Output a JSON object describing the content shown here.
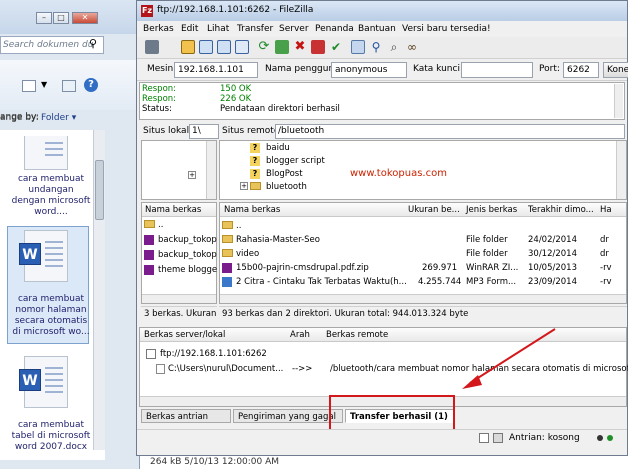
{
  "explorer": {
    "search_placeholder": "Search dokumen du",
    "arrange_label": "ange by:",
    "arrange_value": "Folder",
    "files": [
      "cara membuat undangan dengan microsoft word....",
      "cara membuat nomor halaman secara otomatis di microsoft wo...",
      "cara membuat tabel di microsoft word 2007.docx"
    ],
    "bottom_text": "264 kB      5/10/13  12:00:00 AM"
  },
  "filezilla": {
    "title": "ftp://192.168.1.101:6262 - FileZilla",
    "menu": [
      "Berkas",
      "Edit",
      "Lihat",
      "Transfer",
      "Server",
      "Penanda",
      "Bantuan",
      "Versi baru tersedia!"
    ],
    "conn": {
      "host_label": "Mesin:",
      "host_value": "192.168.1.101",
      "user_label": "Nama pengguna:",
      "user_value": "anonymous",
      "pass_label": "Kata kunci:",
      "pass_value": "",
      "port_label": "Port:",
      "port_value": "6262",
      "connect_label": "Kone"
    },
    "log": [
      {
        "label": "Respon:",
        "text": "150 OK",
        "color": "#008000"
      },
      {
        "label": "Respon:",
        "text": "226 OK",
        "color": "#008000"
      },
      {
        "label": "Status:",
        "text": "Pendataan direktori berhasil",
        "color": "#000000"
      }
    ],
    "local_site_label": "Situs lokal:",
    "local_site_value": "1\\",
    "remote_site_label": "Situs remote:",
    "remote_site_value": "/bluetooth",
    "remote_tree": [
      "baidu",
      "blogger script",
      "BlogPost",
      "bluetooth"
    ],
    "watermark": "www.tokopuas.com",
    "local_header": "Nama berkas",
    "local_files": [
      "..",
      "backup_tokop",
      "backup_tokop",
      "theme blogge"
    ],
    "remote_headers": {
      "name": "Nama berkas",
      "size": "Ukuran be...",
      "type": "Jenis berkas",
      "modified": "Terakhir dimo...",
      "perm": "Ha"
    },
    "remote_files": [
      {
        "name": "..",
        "size": "",
        "type": "",
        "modified": "",
        "perm": ""
      },
      {
        "name": "Rahasia-Master-Seo",
        "size": "",
        "type": "File folder",
        "modified": "24/02/2014",
        "perm": "dr"
      },
      {
        "name": "video",
        "size": "",
        "type": "File folder",
        "modified": "30/12/2014",
        "perm": "dr"
      },
      {
        "name": "15b00-pajrin-cmsdrupal.pdf.zip",
        "size": "269.971",
        "type": "WinRAR ZI...",
        "modified": "10/05/2013",
        "perm": "-rv"
      },
      {
        "name": "2 Citra - Cintaku Tak Terbatas Waktu(h...",
        "size": "4.255.744",
        "type": "MP3 Form...",
        "modified": "23/09/2014",
        "perm": "-rv"
      }
    ],
    "local_status": "3 berkas. Ukuran t",
    "remote_status": "93 berkas dan 2 direktori. Ukuran total: 944.013.324 byte",
    "queue_headers": {
      "server": "Berkas server/lokal",
      "dir": "Arah",
      "remote": "Berkas remote"
    },
    "queue": {
      "server": "ftp://192.168.1.101:6262",
      "local": "C:\\Users\\nurul\\Document...",
      "dir": "-->>",
      "remote": "/bluetooth/cara membuat nomor halaman secara otomatis di microsoft wo"
    },
    "tabs": [
      "Berkas antrian",
      "Pengiriman yang gagal",
      "Transfer berhasil (1)"
    ],
    "queue_status": "Antrian: kosong"
  },
  "colors": {
    "highlight": "#d3171b",
    "watermark": "#cc2200"
  }
}
